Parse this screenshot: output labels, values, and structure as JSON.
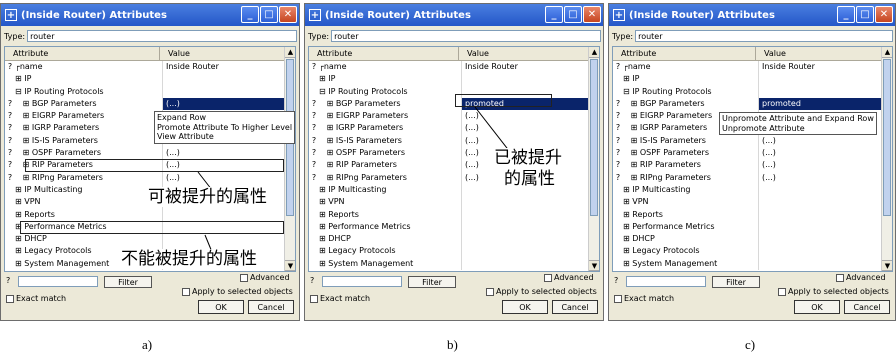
{
  "windows": [
    {
      "id": "a",
      "title": "(Inside Router) Attributes",
      "type_label": "Type:",
      "type_value": "router",
      "col_attr": "Attribute",
      "col_value": "Value",
      "rows": [
        {
          "q": "?",
          "attr": "┌name",
          "value": "Inside Router"
        },
        {
          "q": "",
          "attr": "⊞ IP",
          "value": ""
        },
        {
          "q": "",
          "attr": "⊟ IP Routing Protocols",
          "value": ""
        },
        {
          "q": "?",
          "attr": "   ⊞ BGP Parameters",
          "value": "(...)"
        },
        {
          "q": "?",
          "attr": "   ⊞ EIGRP Parameters",
          "value": "Expand Row"
        },
        {
          "q": "?",
          "attr": "   ⊞ IGRP Parameters",
          "value": "Promote Attribute To Higher Level"
        },
        {
          "q": "?",
          "attr": "   ⊞ IS-IS Parameters",
          "value": "View Attribute"
        },
        {
          "q": "?",
          "attr": "   ⊞ OSPF Parameters",
          "value": "(...)"
        },
        {
          "q": "?",
          "attr": "   ⊞ RIP Parameters",
          "value": "(...)"
        },
        {
          "q": "?",
          "attr": "   ⊞ RIPng Parameters",
          "value": "(...)"
        },
        {
          "q": "",
          "attr": "⊞ IP Multicasting",
          "value": ""
        },
        {
          "q": "",
          "attr": "⊞ VPN",
          "value": ""
        },
        {
          "q": "",
          "attr": "⊞ Reports",
          "value": ""
        },
        {
          "q": "",
          "attr": "⊞ Performance Metrics",
          "value": ""
        },
        {
          "q": "",
          "attr": "⊞ DHCP",
          "value": ""
        },
        {
          "q": "",
          "attr": "⊞ Legacy Protocols",
          "value": ""
        },
        {
          "q": "",
          "attr": "⊞ System Management",
          "value": ""
        }
      ],
      "popup": [
        "Expand Row",
        "Promote Attribute To Higher Level",
        "View Attribute"
      ],
      "advanced": "Advanced",
      "filter": "Filter",
      "exact": "Exact match",
      "apply": "Apply to selected objects",
      "ok": "OK",
      "cancel": "Cancel",
      "annotation1": "可被提升的属性",
      "annotation2": "不能被提升的属性",
      "caption": "a)"
    },
    {
      "id": "b",
      "title": "(Inside Router) Attributes",
      "type_label": "Type:",
      "type_value": "router",
      "col_attr": "Attribute",
      "col_value": "Value",
      "rows": [
        {
          "q": "?",
          "attr": "┌name",
          "value": "Inside Router"
        },
        {
          "q": "",
          "attr": "⊞ IP",
          "value": ""
        },
        {
          "q": "",
          "attr": "⊟ IP Routing Protocols",
          "value": ""
        },
        {
          "q": "?",
          "attr": "   ⊞ BGP Parameters",
          "value": "promoted"
        },
        {
          "q": "?",
          "attr": "   ⊞ EIGRP Parameters",
          "value": "(...)"
        },
        {
          "q": "?",
          "attr": "   ⊞ IGRP Parameters",
          "value": "(...)"
        },
        {
          "q": "?",
          "attr": "   ⊞ IS-IS Parameters",
          "value": "(...)"
        },
        {
          "q": "?",
          "attr": "   ⊞ OSPF Parameters",
          "value": "(...)"
        },
        {
          "q": "?",
          "attr": "   ⊞ RIP Parameters",
          "value": "(...)"
        },
        {
          "q": "?",
          "attr": "   ⊞ RIPng Parameters",
          "value": "(...)"
        },
        {
          "q": "",
          "attr": "⊞ IP Multicasting",
          "value": ""
        },
        {
          "q": "",
          "attr": "⊞ VPN",
          "value": ""
        },
        {
          "q": "",
          "attr": "⊞ Reports",
          "value": ""
        },
        {
          "q": "",
          "attr": "⊞ Performance Metrics",
          "value": ""
        },
        {
          "q": "",
          "attr": "⊞ DHCP",
          "value": ""
        },
        {
          "q": "",
          "attr": "⊞ Legacy Protocols",
          "value": ""
        },
        {
          "q": "",
          "attr": "⊞ System Management",
          "value": ""
        }
      ],
      "advanced": "Advanced",
      "filter": "Filter",
      "exact": "Exact match",
      "apply": "Apply to selected objects",
      "ok": "OK",
      "cancel": "Cancel",
      "annotation1": "已被提升",
      "annotation2": "的属性",
      "caption": "b)"
    },
    {
      "id": "c",
      "title": "(Inside Router) Attributes",
      "type_label": "Type:",
      "type_value": "router",
      "col_attr": "Attribute",
      "col_value": "Value",
      "rows": [
        {
          "q": "?",
          "attr": "┌name",
          "value": "Inside Router"
        },
        {
          "q": "",
          "attr": "⊞ IP",
          "value": ""
        },
        {
          "q": "",
          "attr": "⊟ IP Routing Protocols",
          "value": ""
        },
        {
          "q": "?",
          "attr": "   ⊞ BGP Parameters",
          "value": "promoted"
        },
        {
          "q": "?",
          "attr": "   ⊞ EIGRP Parameters",
          "value": ""
        },
        {
          "q": "?",
          "attr": "   ⊞ IGRP Parameters",
          "value": ""
        },
        {
          "q": "?",
          "attr": "   ⊞ IS-IS Parameters",
          "value": "(...)"
        },
        {
          "q": "?",
          "attr": "   ⊞ OSPF Parameters",
          "value": "(...)"
        },
        {
          "q": "?",
          "attr": "   ⊞ RIP Parameters",
          "value": "(...)"
        },
        {
          "q": "?",
          "attr": "   ⊞ RIPng Parameters",
          "value": "(...)"
        },
        {
          "q": "",
          "attr": "⊞ IP Multicasting",
          "value": ""
        },
        {
          "q": "",
          "attr": "⊞ VPN",
          "value": ""
        },
        {
          "q": "",
          "attr": "⊞ Reports",
          "value": ""
        },
        {
          "q": "",
          "attr": "⊞ Performance Metrics",
          "value": ""
        },
        {
          "q": "",
          "attr": "⊞ DHCP",
          "value": ""
        },
        {
          "q": "",
          "attr": "⊞ Legacy Protocols",
          "value": ""
        },
        {
          "q": "",
          "attr": "⊞ System Management",
          "value": ""
        }
      ],
      "popup": [
        "Unpromote Attribute and Expand Row",
        "Unpromote Attribute"
      ],
      "advanced": "Advanced",
      "filter": "Filter",
      "exact": "Exact match",
      "apply": "Apply to selected objects",
      "ok": "OK",
      "cancel": "Cancel",
      "caption": "c)"
    }
  ],
  "colors": {
    "titlebar": "#2456c8",
    "selection": "#0a246a",
    "dialog_bg": "#ece9d8"
  }
}
